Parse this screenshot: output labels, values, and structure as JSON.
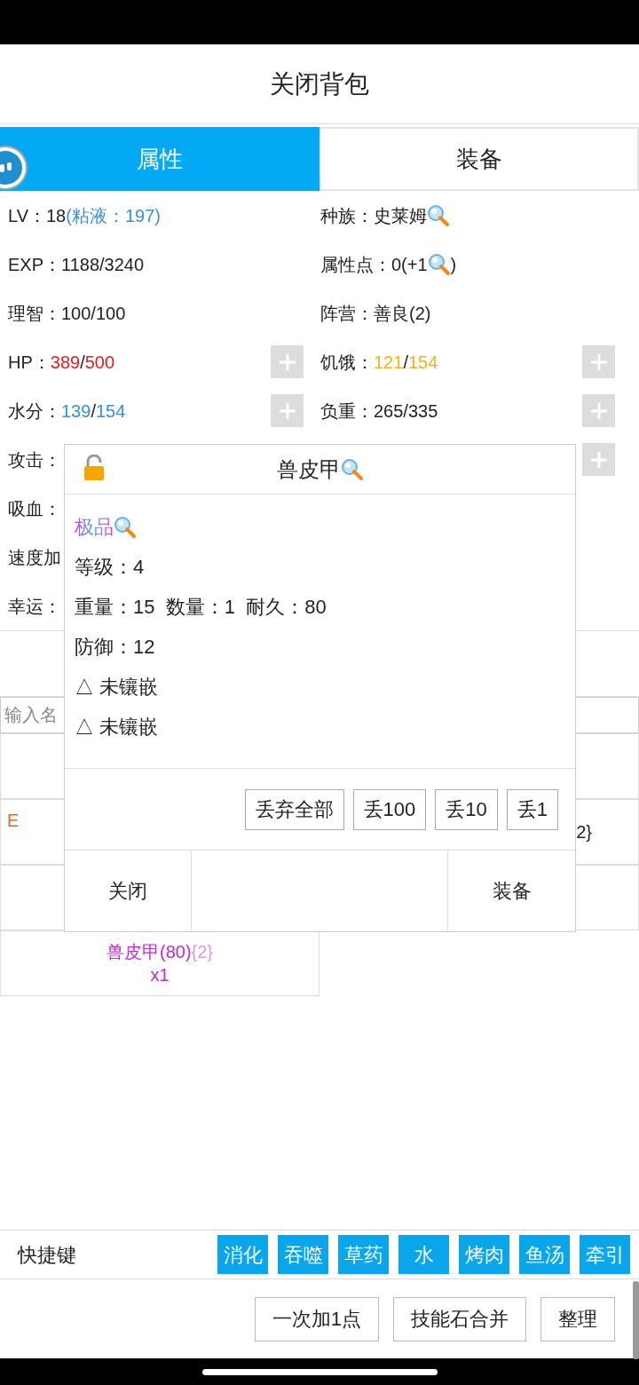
{
  "header": {
    "title": "关闭背包"
  },
  "tabs": [
    {
      "label": "属性",
      "selected": true
    },
    {
      "label": "装备",
      "selected": false
    }
  ],
  "stats": [
    [
      {
        "label": "LV：",
        "parts": [
          {
            "kind": "text",
            "text": "18"
          },
          {
            "kind": "text",
            "text": "(粘液：197)",
            "color": "#3b8fd6"
          }
        ]
      },
      {
        "label": "种族：",
        "parts": [
          {
            "kind": "text",
            "text": "史莱姆"
          },
          {
            "kind": "magnifier"
          }
        ]
      }
    ],
    [
      {
        "label": "EXP：",
        "parts": [
          {
            "kind": "text",
            "text": "1188/3240"
          }
        ]
      },
      {
        "label": "属性点：",
        "parts": [
          {
            "kind": "text",
            "text": "0(+1"
          },
          {
            "kind": "magnifier"
          },
          {
            "kind": "text",
            "text": ")"
          }
        ]
      }
    ],
    [
      {
        "label": "理智：",
        "parts": [
          {
            "kind": "text",
            "text": "100/100"
          }
        ]
      },
      {
        "label": "阵营：",
        "parts": [
          {
            "kind": "text",
            "text": "善良(2)"
          }
        ]
      }
    ],
    [
      {
        "label": "HP：",
        "plus": true,
        "parts": [
          {
            "kind": "text",
            "text": "389",
            "color": "#e02020"
          },
          {
            "kind": "text",
            "text": "/"
          },
          {
            "kind": "text",
            "text": "500",
            "color": "#e02020"
          }
        ]
      },
      {
        "label": "饥饿：",
        "plus": true,
        "parts": [
          {
            "kind": "text",
            "text": "121",
            "color": "#f4b416"
          },
          {
            "kind": "text",
            "text": "/"
          },
          {
            "kind": "text",
            "text": "154",
            "color": "#f4b416"
          }
        ]
      }
    ],
    [
      {
        "label": "水分：",
        "plus": true,
        "parts": [
          {
            "kind": "text",
            "text": "139",
            "color": "#3b8fd6"
          },
          {
            "kind": "text",
            "text": "/"
          },
          {
            "kind": "text",
            "text": "154",
            "color": "#3b8fd6"
          }
        ]
      },
      {
        "label": "负重：",
        "plus": true,
        "parts": [
          {
            "kind": "text",
            "text": "265/335"
          }
        ]
      }
    ],
    [
      {
        "label": "攻击："
      },
      {
        "plus": true
      }
    ],
    [
      {
        "label": "吸血："
      }
    ],
    [
      {
        "label": "速度加"
      }
    ],
    [
      {
        "label": "幸运："
      }
    ]
  ],
  "search": {
    "placeholder": "输入名"
  },
  "inventory": [
    {
      "kind": "empty"
    },
    {
      "kind": "empty"
    },
    {
      "kind": "partial",
      "text": "E",
      "color": "#e8642a"
    },
    {
      "kind": "partial",
      "text": "2}"
    },
    {
      "kind": "empty"
    },
    {
      "kind": "empty"
    },
    {
      "kind": "item",
      "name": "兽皮甲",
      "durability": "(80)",
      "sockets": "{2}",
      "count": "x1"
    }
  ],
  "popup": {
    "title": "兽皮甲",
    "locked": false,
    "lines": [
      {
        "kind": "grade",
        "text": "极品"
      },
      {
        "kind": "text",
        "text": "等级：4"
      },
      {
        "kind": "text",
        "text": "重量：15  数量：1  耐久：80"
      },
      {
        "kind": "text",
        "text": "防御：12"
      },
      {
        "kind": "socket",
        "text": "△ 未镶嵌"
      },
      {
        "kind": "socket",
        "text": "△ 未镶嵌"
      }
    ],
    "drop_buttons": [
      "丢弃全部",
      "丢100",
      "丢10",
      "丢1"
    ],
    "close": "关闭",
    "equip": "装备"
  },
  "quick_keys": {
    "label": "快捷键",
    "keys": [
      "消化",
      "吞噬",
      "草药",
      "水",
      "烤肉",
      "鱼汤",
      "牵引"
    ]
  },
  "bottom_buttons": [
    "一次加1点",
    "技能石合并",
    "整理"
  ]
}
